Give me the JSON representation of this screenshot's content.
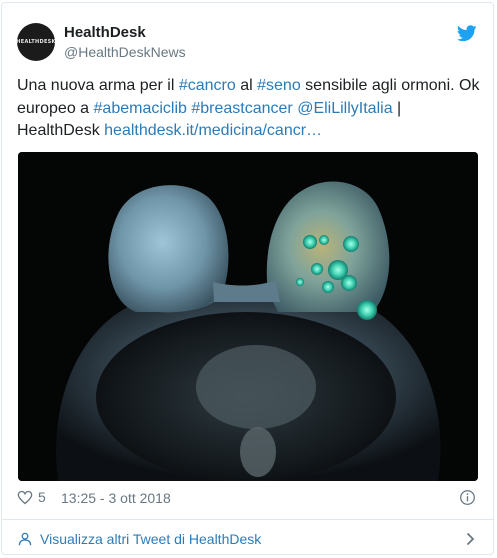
{
  "author": {
    "avatar_text": "HEALTHDESK",
    "name": "HealthDesk",
    "handle": "@HealthDeskNews"
  },
  "tweet": {
    "segments": [
      {
        "text": "Una nuova arma per il ",
        "link": false
      },
      {
        "text": "#cancro",
        "link": true
      },
      {
        "text": " al ",
        "link": false
      },
      {
        "text": "#seno",
        "link": true
      },
      {
        "text": " sensibile agli ormoni. Ok europeo a  ",
        "link": false
      },
      {
        "text": "#abemaciclib",
        "link": true
      },
      {
        "text": " ",
        "link": false
      },
      {
        "text": "#breastcancer",
        "link": true
      },
      {
        "text": " ",
        "link": false
      },
      {
        "text": "@EliLillyItalia",
        "link": true
      },
      {
        "text": " | HealthDesk ",
        "link": false
      },
      {
        "text": "healthdesk.it/medicina/cancr…",
        "link": true
      }
    ]
  },
  "footer": {
    "like_count": "5",
    "timestamp": "13:25 - 3 ott 2018"
  },
  "more_link": "Visualizza altri Tweet di HealthDesk",
  "icons": {
    "brand": "twitter-bird-icon",
    "like": "heart-icon",
    "info": "info-icon",
    "person": "person-icon",
    "chevron": "chevron-right-icon"
  },
  "colors": {
    "link": "#2b7bb9",
    "bird": "#1da1f2",
    "muted": "#697882",
    "text": "#1c2022",
    "border": "#e1e8ed"
  }
}
